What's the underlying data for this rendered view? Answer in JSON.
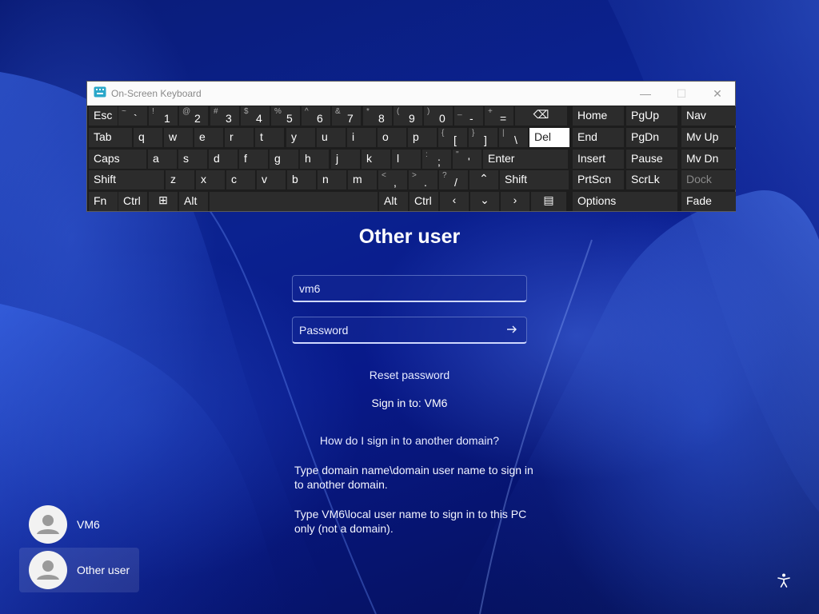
{
  "osk": {
    "title": "On-Screen Keyboard",
    "controls": {
      "minimize": "—",
      "maximize": "☐",
      "close": "✕"
    },
    "rows": [
      [
        {
          "label": "Esc"
        },
        {
          "shift": "~",
          "main": "`"
        },
        {
          "shift": "!",
          "main": "1"
        },
        {
          "shift": "@",
          "main": "2"
        },
        {
          "shift": "#",
          "main": "3"
        },
        {
          "shift": "$",
          "main": "4"
        },
        {
          "shift": "%",
          "main": "5"
        },
        {
          "shift": "^",
          "main": "6"
        },
        {
          "shift": "&",
          "main": "7"
        },
        {
          "shift": "*",
          "main": "8"
        },
        {
          "shift": "(",
          "main": "9"
        },
        {
          "shift": ")",
          "main": "0"
        },
        {
          "shift": "_",
          "main": "-"
        },
        {
          "shift": "+",
          "main": "="
        },
        {
          "icon": "backspace-icon",
          "glyph": "⌫"
        },
        {
          "label": "Home"
        },
        {
          "label": "PgUp"
        },
        {
          "label": "Nav"
        }
      ],
      [
        {
          "label": "Tab"
        },
        {
          "main": "q"
        },
        {
          "main": "w"
        },
        {
          "main": "e"
        },
        {
          "main": "r"
        },
        {
          "main": "t"
        },
        {
          "main": "y"
        },
        {
          "main": "u"
        },
        {
          "main": "i"
        },
        {
          "main": "o"
        },
        {
          "main": "p"
        },
        {
          "shift": "{",
          "main": "["
        },
        {
          "shift": "}",
          "main": "]"
        },
        {
          "shift": "|",
          "main": "\\"
        },
        {
          "label": "Del"
        },
        {
          "label": "End"
        },
        {
          "label": "PgDn"
        },
        {
          "label": "Mv Up"
        }
      ],
      [
        {
          "label": "Caps"
        },
        {
          "main": "a"
        },
        {
          "main": "s"
        },
        {
          "main": "d"
        },
        {
          "main": "f"
        },
        {
          "main": "g"
        },
        {
          "main": "h"
        },
        {
          "main": "j"
        },
        {
          "main": "k"
        },
        {
          "main": "l"
        },
        {
          "shift": ":",
          "main": ";"
        },
        {
          "shift": "\"",
          "main": "'"
        },
        {
          "label": "Enter"
        },
        {
          "label": "Insert"
        },
        {
          "label": "Pause"
        },
        {
          "label": "Mv Dn"
        }
      ],
      [
        {
          "label": "Shift"
        },
        {
          "main": "z"
        },
        {
          "main": "x"
        },
        {
          "main": "c"
        },
        {
          "main": "v"
        },
        {
          "main": "b"
        },
        {
          "main": "n"
        },
        {
          "main": "m"
        },
        {
          "shift": "<",
          "main": ","
        },
        {
          "shift": ">",
          "main": "."
        },
        {
          "shift": "?",
          "main": "/"
        },
        {
          "icon": "arrow-up-icon",
          "glyph": "⌃"
        },
        {
          "label": "Shift"
        },
        {
          "label": "PrtScn"
        },
        {
          "label": "ScrLk"
        },
        {
          "label": "Dock"
        }
      ],
      [
        {
          "label": "Fn"
        },
        {
          "label": "Ctrl"
        },
        {
          "icon": "windows-icon",
          "glyph": "⊞"
        },
        {
          "label": "Alt"
        },
        {
          "label": ""
        },
        {
          "label": "Alt"
        },
        {
          "label": "Ctrl"
        },
        {
          "icon": "arrow-left-icon",
          "glyph": "‹"
        },
        {
          "icon": "arrow-down-icon",
          "glyph": "⌄"
        },
        {
          "icon": "arrow-right-icon",
          "glyph": "›"
        },
        {
          "icon": "menu-key-icon",
          "glyph": "▤"
        },
        {
          "label": "Options"
        },
        {
          "label": "Fade"
        }
      ]
    ]
  },
  "login": {
    "title": "Other user",
    "username_value": "vm6",
    "password_placeholder": "Password",
    "reset_password": "Reset password",
    "sign_in_to": "Sign in to: VM6",
    "other_domain_link": "How do I sign in to another domain?",
    "help_line1": "Type domain name\\domain user name to sign in to another domain.",
    "help_line2": "Type VM6\\local user name to sign in to this PC only (not a domain)."
  },
  "users": [
    {
      "name": "VM6"
    },
    {
      "name": "Other user"
    }
  ],
  "accessibility_icon": "accessibility-icon"
}
